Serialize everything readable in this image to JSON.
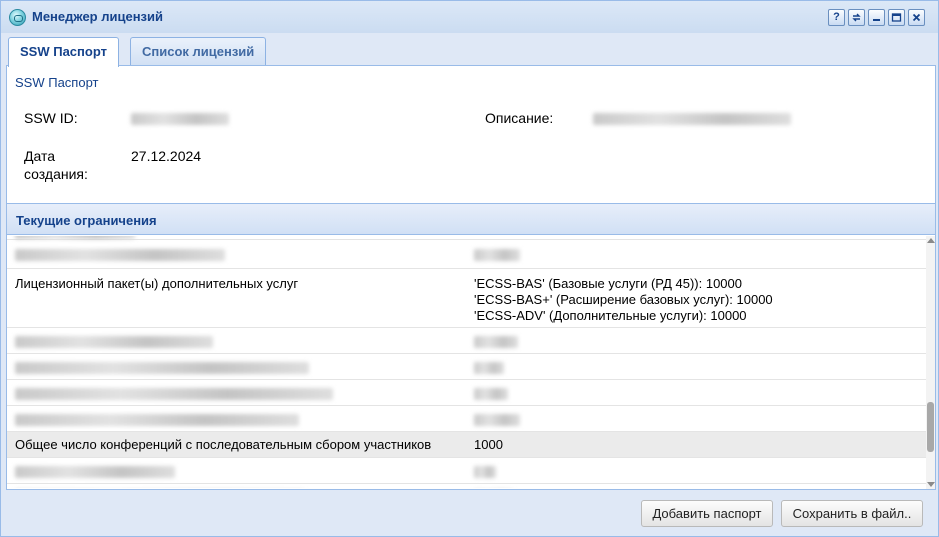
{
  "window": {
    "title": "Менеджер лицензий"
  },
  "tools": [
    "help-icon",
    "refresh-icon",
    "minimize-icon",
    "maximize-icon",
    "close-icon"
  ],
  "tabs": [
    {
      "label": "SSW Паспорт",
      "active": true
    },
    {
      "label": "Список лицензий",
      "active": false
    }
  ],
  "passport": {
    "section_title": "SSW Паспорт",
    "ssw_id_label": "SSW ID:",
    "ssw_id_value": "",
    "description_label": "Описание:",
    "description_value": "",
    "created_label_line1": "Дата",
    "created_label_line2": "создания:",
    "created_value": "27.12.2024"
  },
  "limits": {
    "title": "Текущие ограничения",
    "rows": [
      {
        "name": "",
        "value": "",
        "redacted": true
      },
      {
        "name": "Лицензионный пакет(ы) дополнительных услуг",
        "values": [
          "'ECSS-BAS' (Базовые услуги (РД 45)): 10000",
          "'ECSS-BAS+' (Расширение базовых услуг): 10000",
          "'ECSS-ADV' (Дополнительные услуги): 10000"
        ]
      },
      {
        "name": "",
        "value": "",
        "redacted": true
      },
      {
        "name": "",
        "value": "",
        "redacted": true
      },
      {
        "name": "",
        "value": "",
        "redacted": true
      },
      {
        "name": "",
        "value": "",
        "redacted": true
      },
      {
        "name": "Общее число конференций с последовательным сбором участников",
        "value": "1000",
        "highlighted": true
      },
      {
        "name": "",
        "value": "",
        "redacted": true
      },
      {
        "name": "",
        "value": "",
        "redacted": true
      }
    ]
  },
  "buttons": {
    "add_passport": "Добавить паспорт",
    "save_to_file": "Сохранить в файл.."
  },
  "colors": {
    "accent": "#15428b",
    "border": "#99bbe8",
    "header_bg": "#d1e0f5"
  }
}
